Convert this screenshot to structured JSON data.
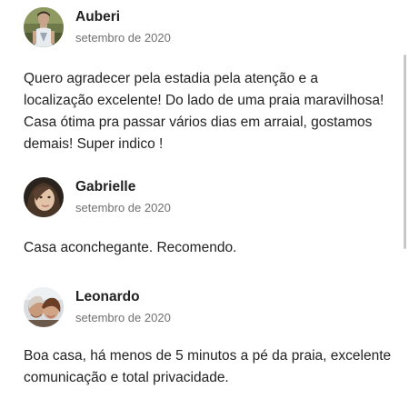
{
  "reviews": [
    {
      "name": "Auberi",
      "date": "setembro de 2020",
      "avatar": "avatar-man-outdoors",
      "lines": [
        "Quero agradecer pela estadia pela atenção e a",
        "localização excelente! Do lado de uma praia maravilhosa!",
        "Casa ótima pra passar vários dias em arraial, gostamos",
        "demais! Super indico !"
      ]
    },
    {
      "name": "Gabrielle",
      "date": "setembro de 2020",
      "avatar": "avatar-woman-selfie",
      "lines": [
        "Casa aconchegante. Recomendo."
      ]
    },
    {
      "name": "Leonardo",
      "date": "setembro de 2020",
      "avatar": "avatar-couple-selfie",
      "lines": [
        "Boa casa, há menos de 5 minutos a pé da praia, excelente",
        "comunicação e total privacidade."
      ]
    }
  ]
}
